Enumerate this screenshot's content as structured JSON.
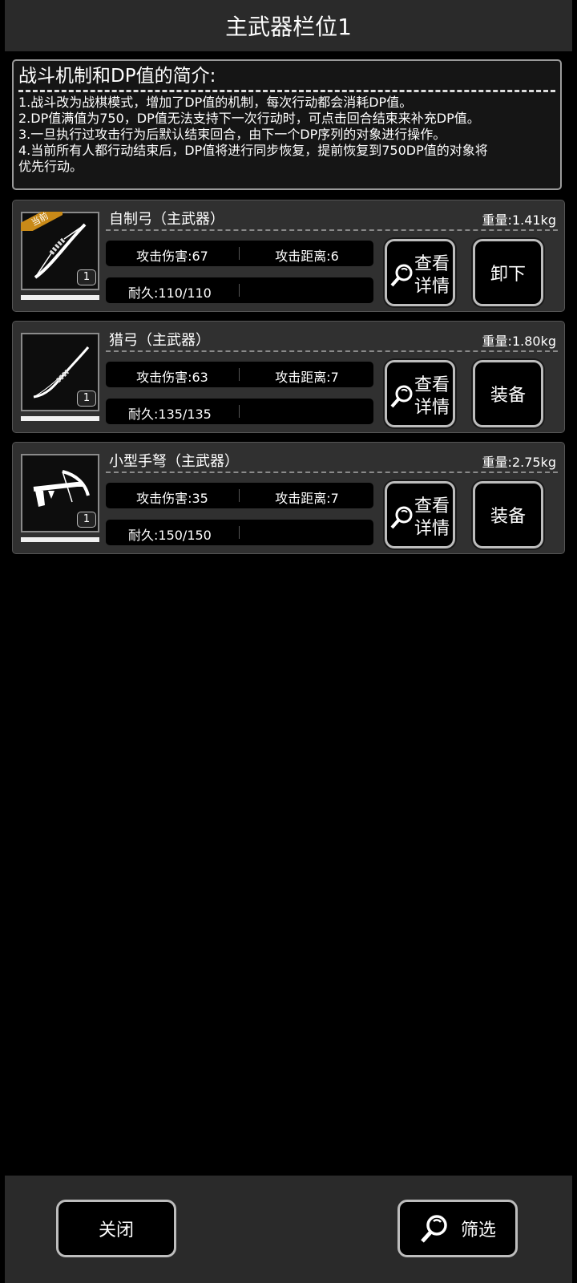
{
  "header": {
    "title": "主武器栏位1"
  },
  "intro": {
    "title": "战斗机制和DP值的简介:",
    "lines": [
      "1.战斗改为战棋模式，增加了DP值的机制，每次行动都会消耗DP值。",
      "2.DP值满值为750，DP值无法支持下一次行动时，可点击回合结束来补充DP值。",
      "3.一旦执行过攻击行为后默认结束回合，由下一个DP序列的对象进行操作。",
      "4.当前所有人都行动结束后，DP值将进行同步恢复，提前恢复到750DP值的对象将",
      "优先行动。"
    ]
  },
  "items": [
    {
      "name": "自制弓（主武器）",
      "weight": "重量:1.41kg",
      "attack": "攻击伤害:67",
      "range": "攻击距离:6",
      "durability": "耐久:110/110",
      "durability_ratio": 1.0,
      "qty": "1",
      "badge": "当前",
      "icon": "bow-icon",
      "detail_label_1": "查看",
      "detail_label_2": "详情",
      "action_label": "卸下"
    },
    {
      "name": "猎弓（主武器）",
      "weight": "重量:1.80kg",
      "attack": "攻击伤害:63",
      "range": "攻击距离:7",
      "durability": "耐久:135/135",
      "durability_ratio": 1.0,
      "qty": "1",
      "icon": "hunting-bow-icon",
      "detail_label_1": "查看",
      "detail_label_2": "详情",
      "action_label": "装备"
    },
    {
      "name": "小型手弩（主武器）",
      "weight": "重量:2.75kg",
      "attack": "攻击伤害:35",
      "range": "攻击距离:7",
      "durability": "耐久:150/150",
      "durability_ratio": 1.0,
      "qty": "1",
      "icon": "crossbow-icon",
      "detail_label_1": "查看",
      "detail_label_2": "详情",
      "action_label": "装备"
    }
  ],
  "footer": {
    "close_label": "关闭",
    "filter_label": "筛选"
  },
  "colors": {
    "badge": "#c98a18",
    "panel": "#303030",
    "bar": "#2a2a2a"
  }
}
